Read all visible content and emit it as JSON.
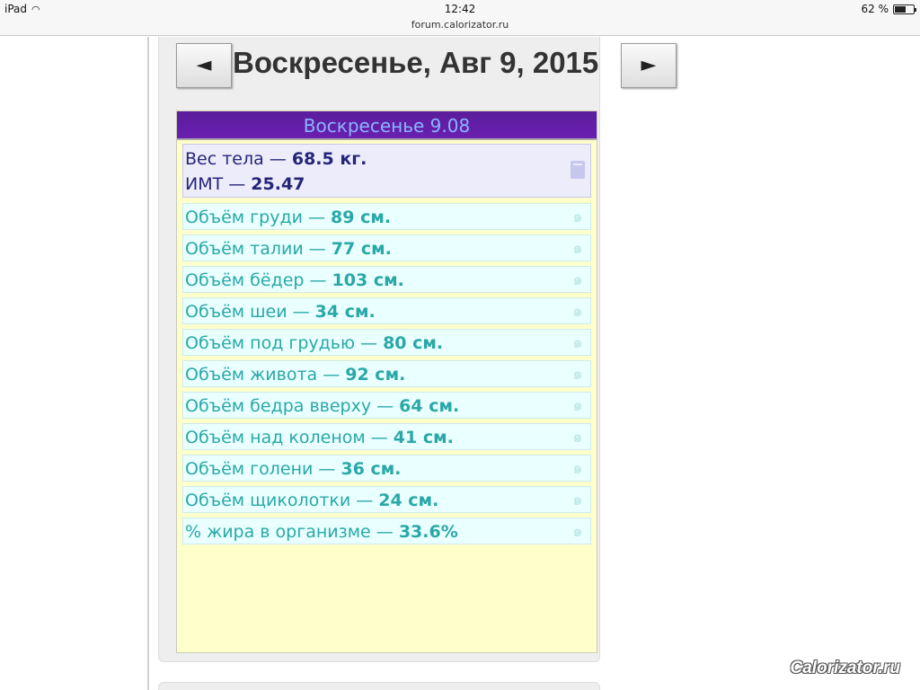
{
  "status_bar": {
    "device": "iPad",
    "time": "12:42",
    "battery": "62 %",
    "battery_level": 0.62
  },
  "browser": {
    "url": "forum.calorizator.ru"
  },
  "calendar": {
    "prev_label": "◄",
    "next_label": "►",
    "date_title": "Воскресенье, Авг 9, 2015"
  },
  "diary": {
    "header": "Воскресенье 9.08",
    "weight": {
      "weight_label": "Вес тела — ",
      "weight_value": "68.5 кг.",
      "bmi_label": "ИМТ — ",
      "bmi_value": "25.47"
    },
    "measurements": [
      {
        "label": "Объём груди — ",
        "value": "89 см."
      },
      {
        "label": "Объём талии — ",
        "value": "77 см."
      },
      {
        "label": "Объём бёдер — ",
        "value": "103 см."
      },
      {
        "label": "Объём шеи — ",
        "value": "34 см."
      },
      {
        "label": "Объём под грудью — ",
        "value": "80 см."
      },
      {
        "label": "Объём живота — ",
        "value": "92 см."
      },
      {
        "label": "Объём бедра вверху — ",
        "value": "64 см."
      },
      {
        "label": "Объём над коленом — ",
        "value": "41 см."
      },
      {
        "label": "Объём голени — ",
        "value": "36 см."
      },
      {
        "label": "Объём щиколотки — ",
        "value": "24 см."
      },
      {
        "label": "% жира в организме — ",
        "value": "33.6%"
      }
    ]
  },
  "watermark": "Calorizator.ru"
}
